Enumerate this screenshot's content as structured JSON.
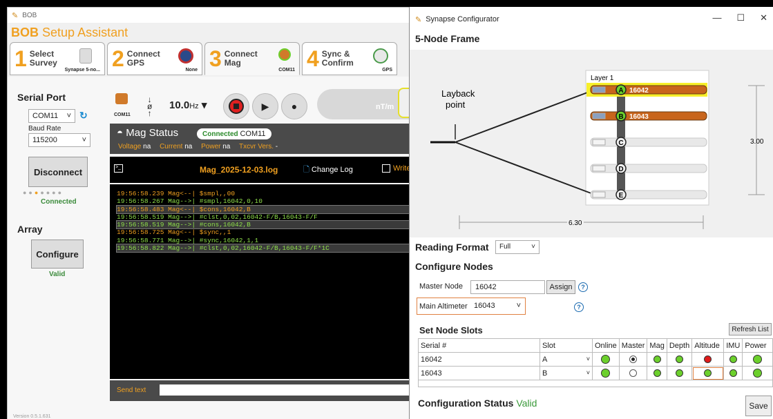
{
  "bob": {
    "window_title": "BOB",
    "app_title_1": "BOB",
    "app_title_2": "Setup Assistant",
    "steps": [
      {
        "num": "1",
        "label": "Select Survey",
        "sub": "Synapse 5-no..."
      },
      {
        "num": "2",
        "label": "Connect GPS",
        "sub": "None"
      },
      {
        "num": "3",
        "label": "Connect Mag",
        "sub": "COM11"
      },
      {
        "num": "4",
        "label": "Sync & Confirm",
        "sub": "GPS"
      }
    ],
    "serial_port_heading": "Serial Port",
    "port": "COM11",
    "baud_label": "Baud Rate",
    "baud": "115200",
    "disconnect_label": "Disconnect",
    "connected_label": "Connected",
    "array_heading": "Array",
    "configure_label": "Configure",
    "valid_label": "Valid",
    "toolbar_com": "COM11",
    "rate_value": "10.0",
    "rate_unit": "Hz",
    "nt_label": "nT/m",
    "mag_status_title": "Mag Status",
    "mag_connected": "Connected",
    "mag_com": "COM11",
    "fields": [
      {
        "k": "Voltage",
        "v": "na"
      },
      {
        "k": "Current",
        "v": "na"
      },
      {
        "k": "Power",
        "v": "na"
      },
      {
        "k": "Txcvr Vers.",
        "v": "-"
      }
    ],
    "log_file": "Mag_2025-12-03.log",
    "change_log": "Change Log",
    "write_label": "Write",
    "log_lines": [
      {
        "text": "19:56:58.239 Mag<--| $smpl,,00",
        "color": "#f0a020",
        "hl": false
      },
      {
        "text": "19:56:58.267 Mag-->| #smpl,16042,0,10",
        "color": "#8fe04a",
        "hl": false
      },
      {
        "text": "19:56:58.483 Mag<--| $cons,16042,B",
        "color": "#f0a020",
        "hl": true
      },
      {
        "text": "19:56:58.519 Mag-->| #clst,0,02,16042-F/B,16043-F/F",
        "color": "#8fe04a",
        "hl": false
      },
      {
        "text": "19:56:58.519 Mag-->| #cons,16042,B",
        "color": "#8fe04a",
        "hl": true
      },
      {
        "text": "19:56:58.725 Mag<--| $sync,,1",
        "color": "#f0a020",
        "hl": false
      },
      {
        "text": "19:56:58.771 Mag-->| #sync,16042,1,1",
        "color": "#8fe04a",
        "hl": false
      },
      {
        "text": "19:56:58.822 Mag-->| #clst,0,02,16042-F/B,16043-F/F*1C",
        "color": "#8fe04a",
        "hl": true
      }
    ],
    "send_label": "Send text",
    "version": "Version 0.5.1.631"
  },
  "cfg": {
    "window_title": "Synapse Configurator",
    "frame_title": "5-Node Frame",
    "layer_label": "Layer 1",
    "layback_label_1": "Layback",
    "layback_label_2": "point",
    "nodes": [
      {
        "letter": "A",
        "serial": "16042",
        "active": true
      },
      {
        "letter": "B",
        "serial": "16043",
        "active": true
      },
      {
        "letter": "C",
        "serial": "",
        "active": false
      },
      {
        "letter": "D",
        "serial": "",
        "active": false
      },
      {
        "letter": "E",
        "serial": "",
        "active": false
      }
    ],
    "dim_height": "3.00",
    "dim_width": "6.30",
    "reading_format_label": "Reading Format",
    "reading_format_value": "Full",
    "configure_nodes_heading": "Configure Nodes",
    "master_node_label": "Master Node",
    "master_node_value": "16042",
    "assign_label": "Assign",
    "main_altimeter_label": "Main Altimeter",
    "main_altimeter_value": "16043",
    "help_glyph": "?",
    "set_slots_heading": "Set Node Slots",
    "refresh_label": "Refresh List",
    "columns": [
      "Serial #",
      "Slot",
      "Online",
      "Master",
      "Mag",
      "Depth",
      "Altitude",
      "IMU",
      "Power"
    ],
    "rows": [
      {
        "serial": "16042",
        "slot": "A",
        "master": true,
        "altitude": "red"
      },
      {
        "serial": "16043",
        "slot": "B",
        "master": false,
        "altitude": "green"
      }
    ],
    "status_label": "Configuration Status",
    "status_value": "Valid",
    "save_label": "Save"
  }
}
